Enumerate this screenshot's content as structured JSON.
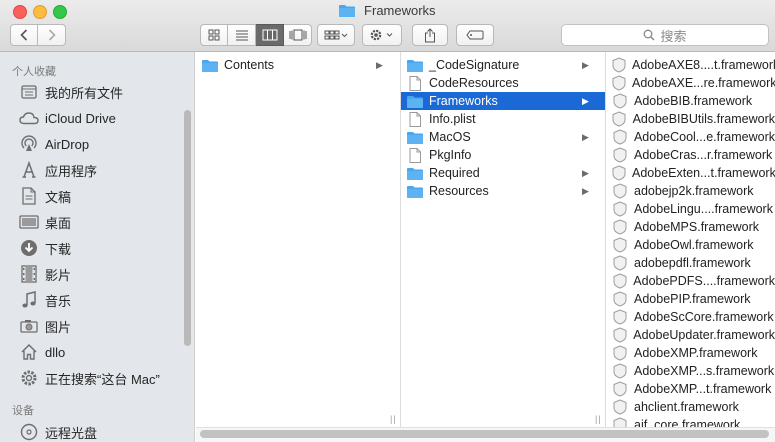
{
  "window": {
    "title": "Frameworks"
  },
  "toolbar": {
    "search_placeholder": "搜索"
  },
  "sidebar": {
    "sections": [
      {
        "heading": "个人收藏"
      },
      {
        "heading": "设备"
      }
    ],
    "items": [
      {
        "label": "我的所有文件",
        "icon": "all-files-icon"
      },
      {
        "label": "iCloud Drive",
        "icon": "cloud-icon"
      },
      {
        "label": "AirDrop",
        "icon": "airdrop-icon"
      },
      {
        "label": "应用程序",
        "icon": "applications-icon"
      },
      {
        "label": "文稿",
        "icon": "documents-icon"
      },
      {
        "label": "桌面",
        "icon": "desktop-icon"
      },
      {
        "label": "下载",
        "icon": "downloads-icon"
      },
      {
        "label": "影片",
        "icon": "movies-icon"
      },
      {
        "label": "音乐",
        "icon": "music-icon"
      },
      {
        "label": "图片",
        "icon": "pictures-icon"
      },
      {
        "label": "dllo",
        "icon": "home-icon"
      },
      {
        "label": "正在搜索“这台 Mac”",
        "icon": "gear-icon"
      },
      {
        "label": "远程光盘",
        "icon": "disc-icon"
      }
    ]
  },
  "columns": {
    "col1": [
      {
        "label": "Contents",
        "type": "folder",
        "has_children": true
      }
    ],
    "col2": [
      {
        "label": "_CodeSignature",
        "type": "folder",
        "has_children": true
      },
      {
        "label": "CodeResources",
        "type": "file",
        "has_children": false
      },
      {
        "label": "Frameworks",
        "type": "folder",
        "has_children": true,
        "selected": true
      },
      {
        "label": "Info.plist",
        "type": "file",
        "has_children": false
      },
      {
        "label": "MacOS",
        "type": "folder",
        "has_children": true
      },
      {
        "label": "PkgInfo",
        "type": "file",
        "has_children": false
      },
      {
        "label": "Required",
        "type": "folder",
        "has_children": true
      },
      {
        "label": "Resources",
        "type": "folder",
        "has_children": true
      }
    ],
    "col3": [
      {
        "label": "AdobeAXE8....t.framework"
      },
      {
        "label": "AdobeAXE...re.framework"
      },
      {
        "label": "AdobeBIB.framework"
      },
      {
        "label": "AdobeBIBUtils.framework"
      },
      {
        "label": "AdobeCool...e.framework"
      },
      {
        "label": "AdobeCras...r.framework"
      },
      {
        "label": "AdobeExten...t.framework"
      },
      {
        "label": "adobejp2k.framework"
      },
      {
        "label": "AdobeLingu....framework"
      },
      {
        "label": "AdobeMPS.framework"
      },
      {
        "label": "AdobeOwl.framework"
      },
      {
        "label": "adobepdfl.framework"
      },
      {
        "label": "AdobePDFS....framework"
      },
      {
        "label": "AdobePIP.framework"
      },
      {
        "label": "AdobeScCore.framework"
      },
      {
        "label": "AdobeUpdater.framework"
      },
      {
        "label": "AdobeXMP.framework"
      },
      {
        "label": "AdobeXMP...s.framework"
      },
      {
        "label": "AdobeXMP...t.framework"
      },
      {
        "label": "ahclient.framework"
      },
      {
        "label": "aif_core.framework"
      }
    ]
  },
  "colors": {
    "selection": "#1a69d6",
    "folder": "#4aa6ee",
    "sidebar_bg": "#e3e6ea"
  }
}
